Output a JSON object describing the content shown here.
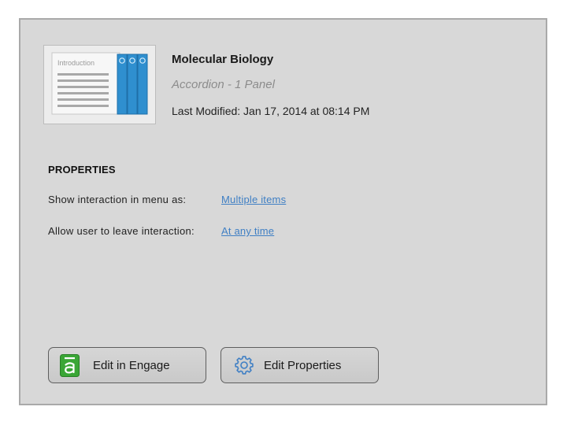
{
  "item": {
    "title": "Molecular Biology",
    "type": "Accordion - 1 Panel",
    "last_modified": "Last Modified: Jan 17, 2014 at 08:14 PM",
    "thumbnail": {
      "label": "Introduction",
      "icon": "accordion-thumbnail-icon",
      "accent_color": "#2f8fcf"
    }
  },
  "properties": {
    "heading": "PROPERTIES",
    "rows": [
      {
        "label": "Show interaction in menu as:",
        "value": "Multiple items"
      },
      {
        "label": "Allow user to leave interaction:",
        "value": "At any time"
      }
    ]
  },
  "buttons": {
    "edit_engage": {
      "label": "Edit in Engage",
      "icon": "engage-icon",
      "icon_color": "#3aa636"
    },
    "edit_properties": {
      "label": "Edit Properties",
      "icon": "gear-icon",
      "icon_color": "#3f7fc4"
    }
  },
  "colors": {
    "panel_bg": "#d8d8d8",
    "link": "#3f7fc4"
  }
}
